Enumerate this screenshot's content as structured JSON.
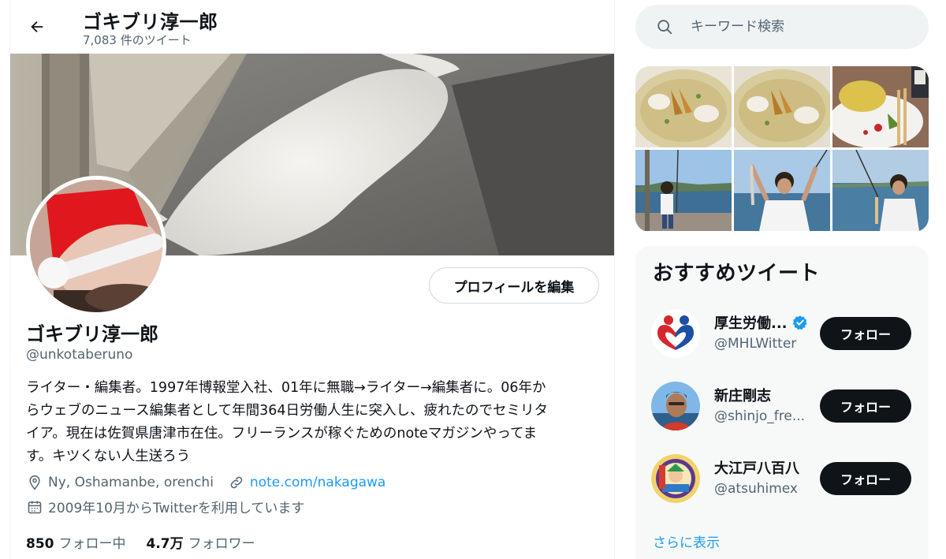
{
  "header": {
    "name": "ゴキブリ淳一郎",
    "tweet_count": "7,083 件のツイート"
  },
  "profile": {
    "edit_button": "プロフィールを編集",
    "name": "ゴキブリ淳一郎",
    "handle": "@unkotaberuno",
    "bio_lines": [
      "ライター・編集者。1997年博報堂入社、01年に無職→ライター→編集者に。06年か",
      "らウェブのニュース編集者として年間364日労働人生に突入し、疲れたのでセミリタ",
      "イア。現在は佐賀県唐津市在住。フリーランスが稼ぐためのnoteマガジンやってま",
      "す。キツくない人生送ろう"
    ],
    "location": "Ny, Oshamanbe, orenchi",
    "website": "note.com/nakagawa",
    "joined": "2009年10月からTwitterを利用しています",
    "following_count": "850",
    "following_label": "フォロー中",
    "followers_count": "4.7万",
    "followers_label": "フォロワー"
  },
  "search": {
    "placeholder": "キーワード検索"
  },
  "recommendations": {
    "title": "おすすめツイート",
    "items": [
      {
        "name": "厚生労働...",
        "handle": "@MHLWitter",
        "verified": true,
        "button": "フォロー"
      },
      {
        "name": "新庄剛志",
        "handle": "@shinjo_fre...",
        "verified": false,
        "button": "フォロー"
      },
      {
        "name": "大江戸八百八",
        "handle": "@atsuhimex",
        "verified": false,
        "button": "フォロー"
      }
    ],
    "show_more": "さらに表示"
  },
  "colors": {
    "accent": "#1d9bf0",
    "text_primary": "#0f1419",
    "text_secondary": "#536471",
    "button_dark": "#0f1419"
  }
}
